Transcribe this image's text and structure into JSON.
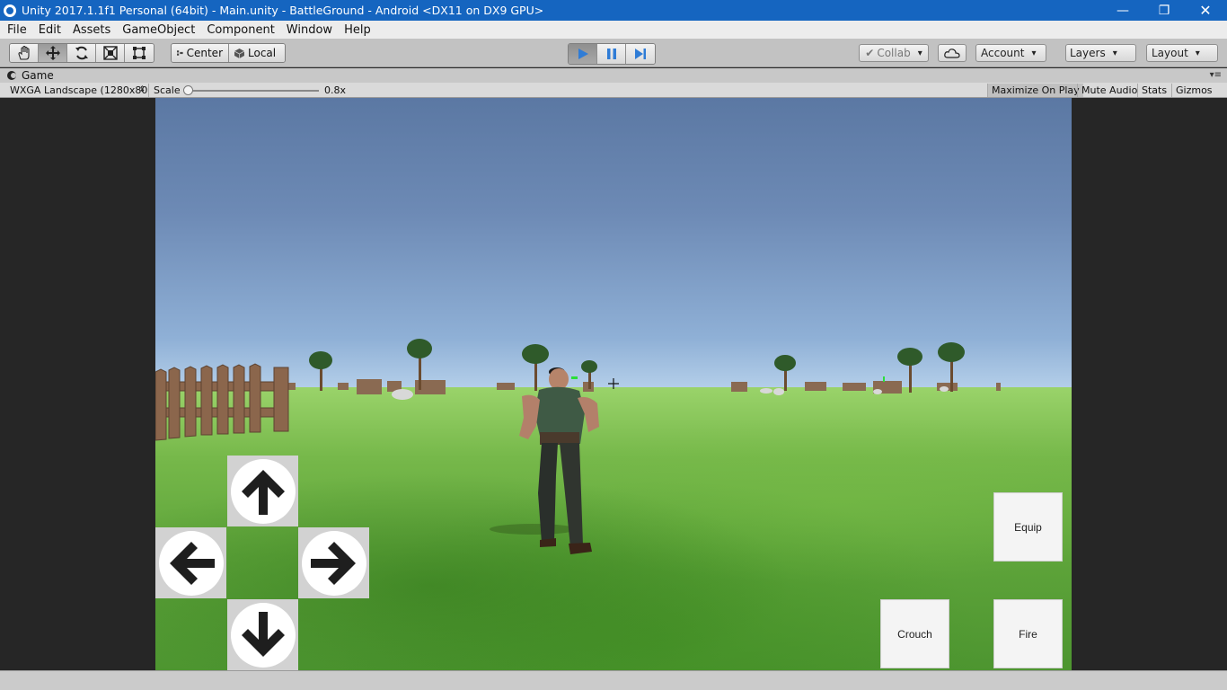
{
  "window": {
    "title": "Unity 2017.1.1f1 Personal (64bit) - Main.unity - BattleGround - Android <DX11 on DX9 GPU>",
    "controls": {
      "minimize": "—",
      "maximize": "❐",
      "close": "✕"
    }
  },
  "menu": [
    "File",
    "Edit",
    "Assets",
    "GameObject",
    "Component",
    "Window",
    "Help"
  ],
  "toolbar": {
    "tools": [
      "hand-icon",
      "move-icon",
      "rotate-icon",
      "scale-icon",
      "rect-icon"
    ],
    "active_tool": "move-icon",
    "pivot_center": "Center",
    "pivot_local": "Local",
    "play_state": "playing",
    "collab": "Collab",
    "account": "Account",
    "layers": "Layers",
    "layout": "Layout"
  },
  "game_view": {
    "tab": "Game",
    "resolution": "WXGA Landscape (1280x80",
    "scale_label": "Scale",
    "scale_value": "0.8x",
    "scale_fraction": 0.0,
    "maximize_on_play": "Maximize On Play",
    "mute_audio": "Mute Audio",
    "stats": "Stats",
    "gizmos": "Gizmos"
  },
  "controls": {
    "up": "arrow-up-icon",
    "left": "arrow-left-icon",
    "right": "arrow-right-icon",
    "down": "arrow-down-icon",
    "equip": "Equip",
    "crouch": "Crouch",
    "fire": "Fire"
  },
  "colors": {
    "titlebar": "#1565c0",
    "play_active": "#2f7cd6",
    "sky_top": "#5b78a3",
    "grass": "#5ea43a"
  }
}
